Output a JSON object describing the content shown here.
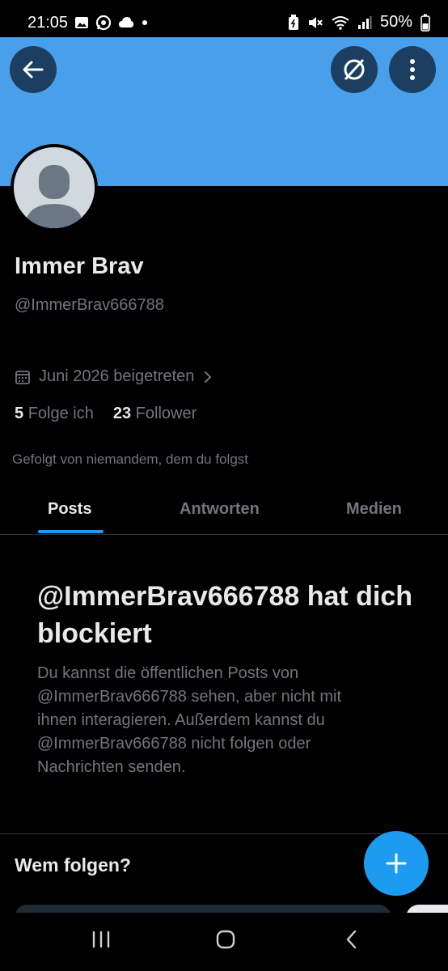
{
  "status_bar": {
    "time": "21:05",
    "battery": "50%",
    "left_icons": [
      "gallery-icon",
      "whatsapp-icon",
      "cloud-icon",
      "dot-icon"
    ],
    "right_icons": [
      "battery-saver-icon",
      "mute-icon",
      "wifi-icon",
      "signal-icon",
      "battery-icon"
    ]
  },
  "header": {
    "banner_color": "#4a9fea",
    "back_icon": "arrow-left-icon",
    "grok_icon": "grok-icon",
    "more_icon": "more-vertical-icon"
  },
  "profile": {
    "name": "Immer Brav",
    "handle": "@ImmerBrav666788",
    "joined": "Juni 2026 beigetreten",
    "following_count": "5",
    "following_label": "Folge ich",
    "followers_count": "23",
    "followers_label": "Follower",
    "followed_by": "Gefolgt von niemandem, dem du folgst"
  },
  "tabs": [
    {
      "label": "Posts",
      "active": true
    },
    {
      "label": "Antworten",
      "active": false
    },
    {
      "label": "Medien",
      "active": false
    }
  ],
  "blocked": {
    "title": "@ImmerBrav666788 hat dich blockiert",
    "text": "Du kannst die öffentlichen Posts von @ImmerBrav666788 sehen, aber nicht mit ihnen interagieren. Außerdem kannst du @ImmerBrav666788 nicht folgen oder Nachrichten senden."
  },
  "who_to_follow": {
    "title": "Wem folgen?"
  },
  "fab_icon": "plus-icon",
  "accent_color": "#1d9bf0",
  "nav": [
    "recent-apps-icon",
    "home-icon",
    "back-icon"
  ]
}
